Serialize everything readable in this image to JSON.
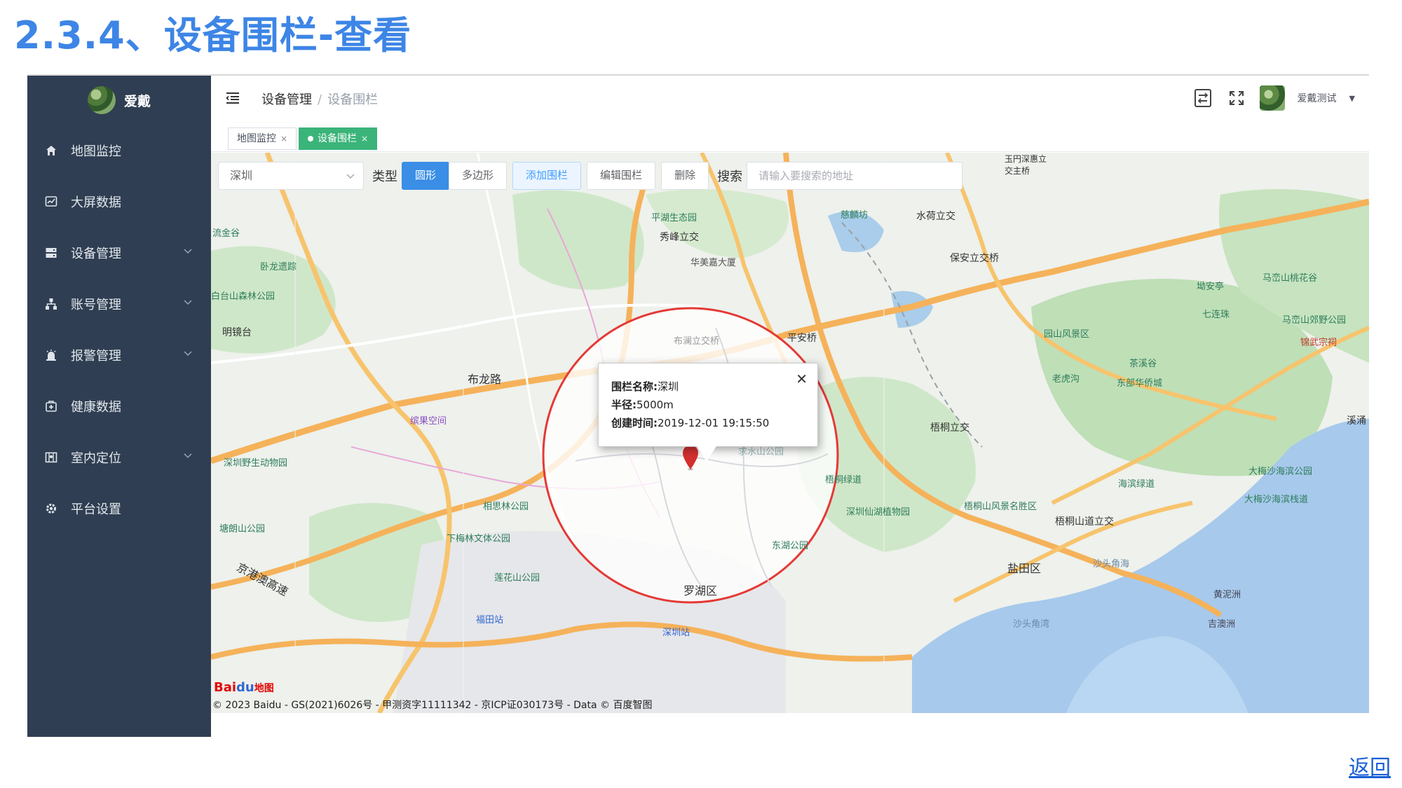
{
  "doc_title": "2.3.4、设备围栏-查看",
  "sidebar": {
    "brand": "爱戴",
    "items": [
      {
        "label": "地图监控",
        "icon": "home-icon"
      },
      {
        "label": "大屏数据",
        "icon": "chart-icon"
      },
      {
        "label": "设备管理",
        "icon": "server-icon"
      },
      {
        "label": "账号管理",
        "icon": "org-icon"
      },
      {
        "label": "报警管理",
        "icon": "alarm-icon"
      },
      {
        "label": "健康数据",
        "icon": "health-icon"
      },
      {
        "label": "室内定位",
        "icon": "map-icon"
      },
      {
        "label": "平台设置",
        "icon": "gear-icon"
      }
    ]
  },
  "header": {
    "breadcrumb": [
      "设备管理",
      "设备围栏"
    ],
    "user": "爱戴测试"
  },
  "tags": [
    {
      "label": "地图监控",
      "active": false
    },
    {
      "label": "设备围栏",
      "active": true
    }
  ],
  "toolbar": {
    "city": "深圳",
    "type_label": "类型",
    "circle": "圆形",
    "polygon": "多边形",
    "add": "添加围栏",
    "edit": "编辑围栏",
    "delete": "删除",
    "search_label": "搜索",
    "search_placeholder": "请输入要搜索的地址"
  },
  "popup": {
    "name_label": "围栏名称:",
    "name": "深圳",
    "radius_label": "半径:",
    "radius": "5000m",
    "created_label": "创建时间:",
    "created": "2019-12-01 19:15:50"
  },
  "map": {
    "labels": [
      "平湖生态园",
      "秀峰立交",
      "华美嘉大厦",
      "慈麟坊",
      "水荷立交",
      "保安立交桥",
      "马峦山桃花谷",
      "马峦山郊野公园",
      "锦武宗祠",
      "园山风景区",
      "老虎沟",
      "茶溪谷",
      "东部华侨城",
      "七连珠",
      "坳安亭",
      "流金谷",
      "卧龙遗踪",
      "白台山森林公园",
      "明镜台",
      "布龙路",
      "缤果空间",
      "深圳野生动物园",
      "相思林公园",
      "塘朗山公园",
      "下梅林文体公园",
      "莲花山公园",
      "福田站",
      "罗湖区",
      "盐田区",
      "梧桐立交",
      "梧桐绿道",
      "深圳仙湖植物园",
      "梧桐山风景名胜区",
      "梧桐山道立交",
      "海滨绿道",
      "大梅沙海滨公园",
      "大梅沙海滨栈道",
      "沙头角海",
      "黄泥洲",
      "吉澳洲",
      "沙头角湾",
      "京港澳高速",
      "平安桥",
      "东湖公园",
      "溪涌",
      "深圳站",
      "玉円深惠立交主桥",
      "布澜立交桥",
      "求水山公园"
    ],
    "copyright": "© 2023 Baidu - GS(2021)6026号 - 甲测资字11111342 - 京ICP证030173号 - Data © 百度智图",
    "logo": "Bai",
    "logo_blue": "du",
    "logo_suffix": "地图"
  },
  "back_link": "返回",
  "colors": {
    "sidebar": "#2f3e52",
    "primary": "#3a8ee6",
    "tag_active": "#3bb47a",
    "fence": "#e53935"
  }
}
